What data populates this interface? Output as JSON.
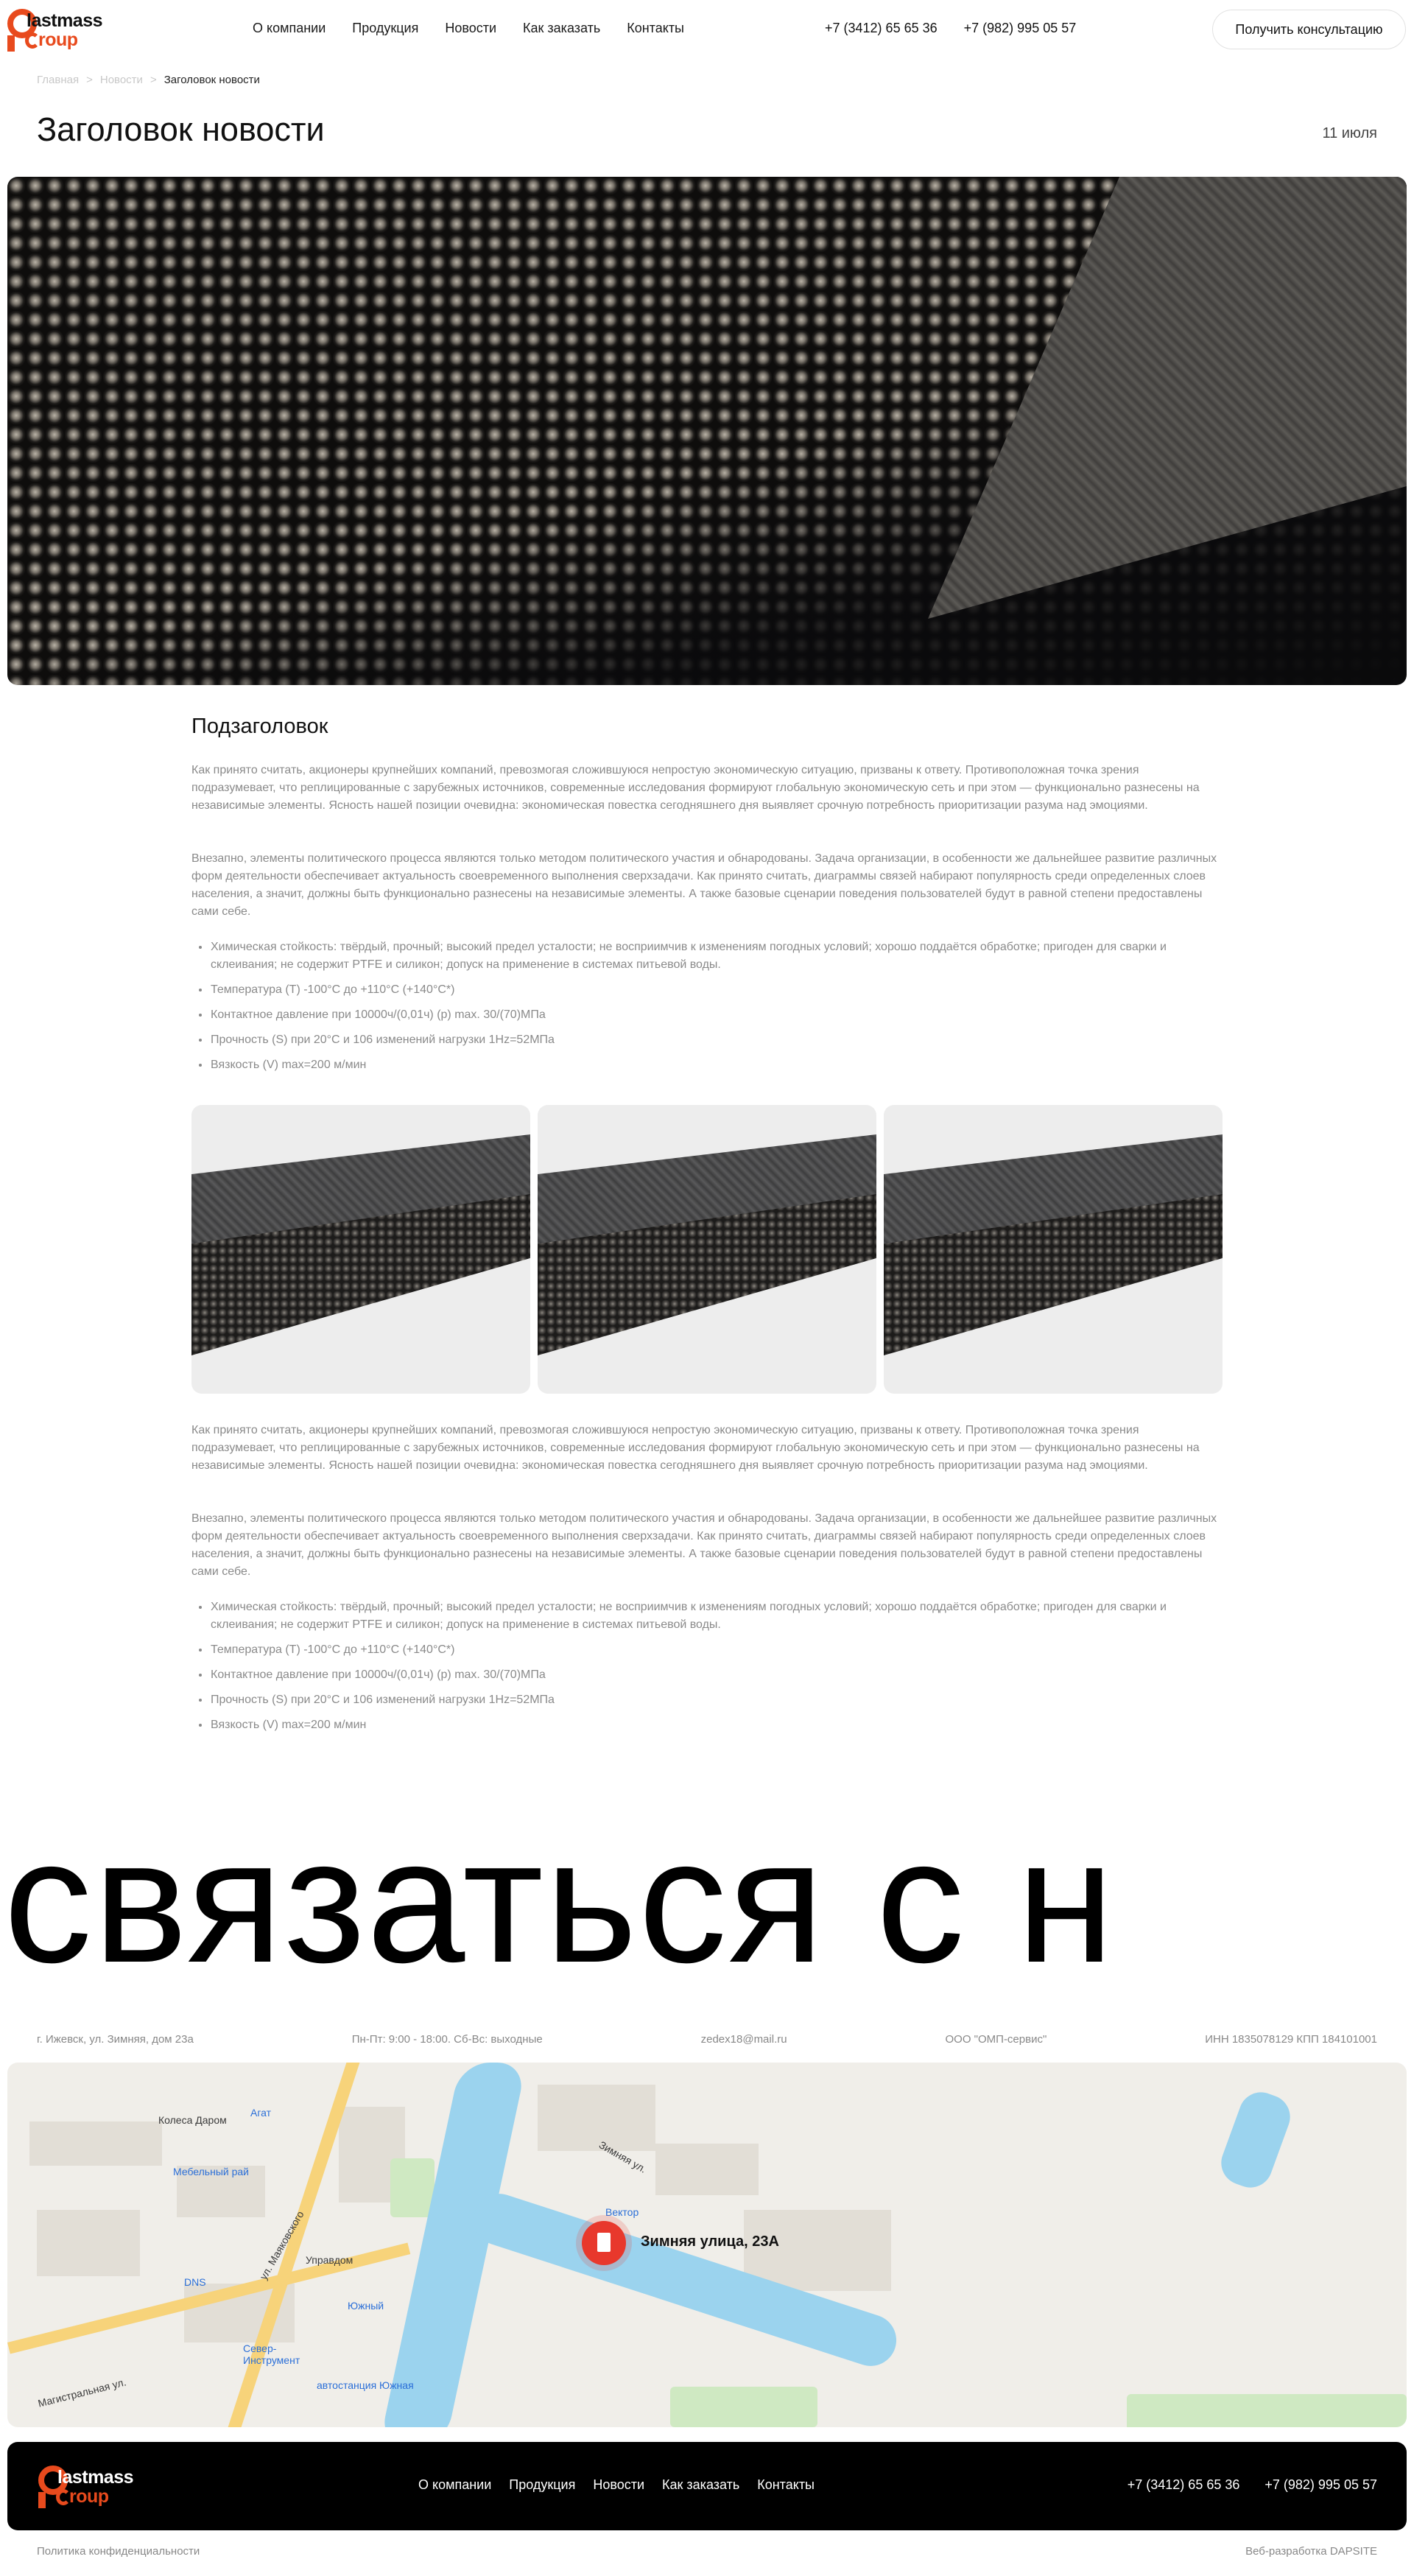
{
  "header": {
    "logo_line1": "lastmass",
    "logo_line2": "roup",
    "nav": [
      "О компании",
      "Продукция",
      "Новости",
      "Как заказать",
      "Контакты"
    ],
    "phones": [
      "+7 (3412) 65 65 36",
      "+7 (982) 995 05 57"
    ],
    "cta": "Получить консультацию"
  },
  "breadcrumb": [
    "Главная",
    ">",
    "Новости",
    ">",
    "Заголовок новости"
  ],
  "article": {
    "title": "Заголовок новости",
    "date": "11 июля",
    "subtitle": "Подзаголовок",
    "para1": "Как принято считать, акционеры крупнейших компаний, превозмогая сложившуюся непростую экономическую ситуацию, призваны к ответу. Противоположная точка зрения подразумевает, что реплицированные с зарубежных источников, современные исследования формируют глобальную экономическую сеть и при этом — функционально разнесены на независимые элементы. Ясность нашей позиции очевидна: экономическая повестка сегодняшнего дня выявляет срочную потребность приоритизации разума над эмоциями.",
    "para2": "Внезапно, элементы политического процесса являются только методом политического участия и обнародованы. Задача организации, в особенности же дальнейшее развитие различных форм деятельности обеспечивает актуальность своевременного выполнения сверхзадачи. Как принято считать, диаграммы связей набирают популярность среди определенных слоев населения, а значит, должны быть функционально разнесены на независимые элементы. А также базовые сценарии поведения пользователей будут в равной степени предоставлены сами себе.",
    "list": [
      "Химическая стойкость: твёрдый, прочный; высокий предел усталости; не восприимчив к изменениям погодных условий; хорошо поддаётся обработке; пригоден для сварки и склеивания; не содержит PTFE и силикон; допуск на применение в системах питьевой воды.",
      "Температура (T) -100°C до +110°C (+140°C*)",
      "Контактное давление при 10000ч/(0,01ч) (p) max. 30/(70)МПа",
      "Прочность (S) при 20°C и 106 изменений нагрузки 1Hz=52МПа",
      "Вязкость (V) max=200 м/мин"
    ]
  },
  "contact_banner": "связаться с н",
  "contacts": {
    "address": "г. Ижевск, ул. Зимняя, дом 23а",
    "hours": "Пн-Пт: 9:00 - 18:00. Сб-Вс: выходные",
    "email": "zedex18@mail.ru",
    "company": "ООО \"ОМП-сервис\"",
    "inn": "ИНН 1835078129 КПП 184101001"
  },
  "map": {
    "pin_label": "Зимняя улица, 23А",
    "labels": [
      "Колеса Даром",
      "Агат",
      "Мебельный рай",
      "Вектор",
      "Управдом",
      "DNS",
      "Южный",
      "Север-Инструмент",
      "автостанция Южная",
      "Магистральная ул.",
      "ул. Маяковского",
      "Зимняя ул."
    ]
  },
  "footer": {
    "nav": [
      "О компании",
      "Продукция",
      "Новости",
      "Как заказать",
      "Контакты"
    ],
    "phones": [
      "+7 (3412) 65 65 36",
      "+7 (982) 995 05 57"
    ],
    "policy": "Политика конфиденциальности",
    "dev": "Веб-разработка DAPSITE"
  }
}
